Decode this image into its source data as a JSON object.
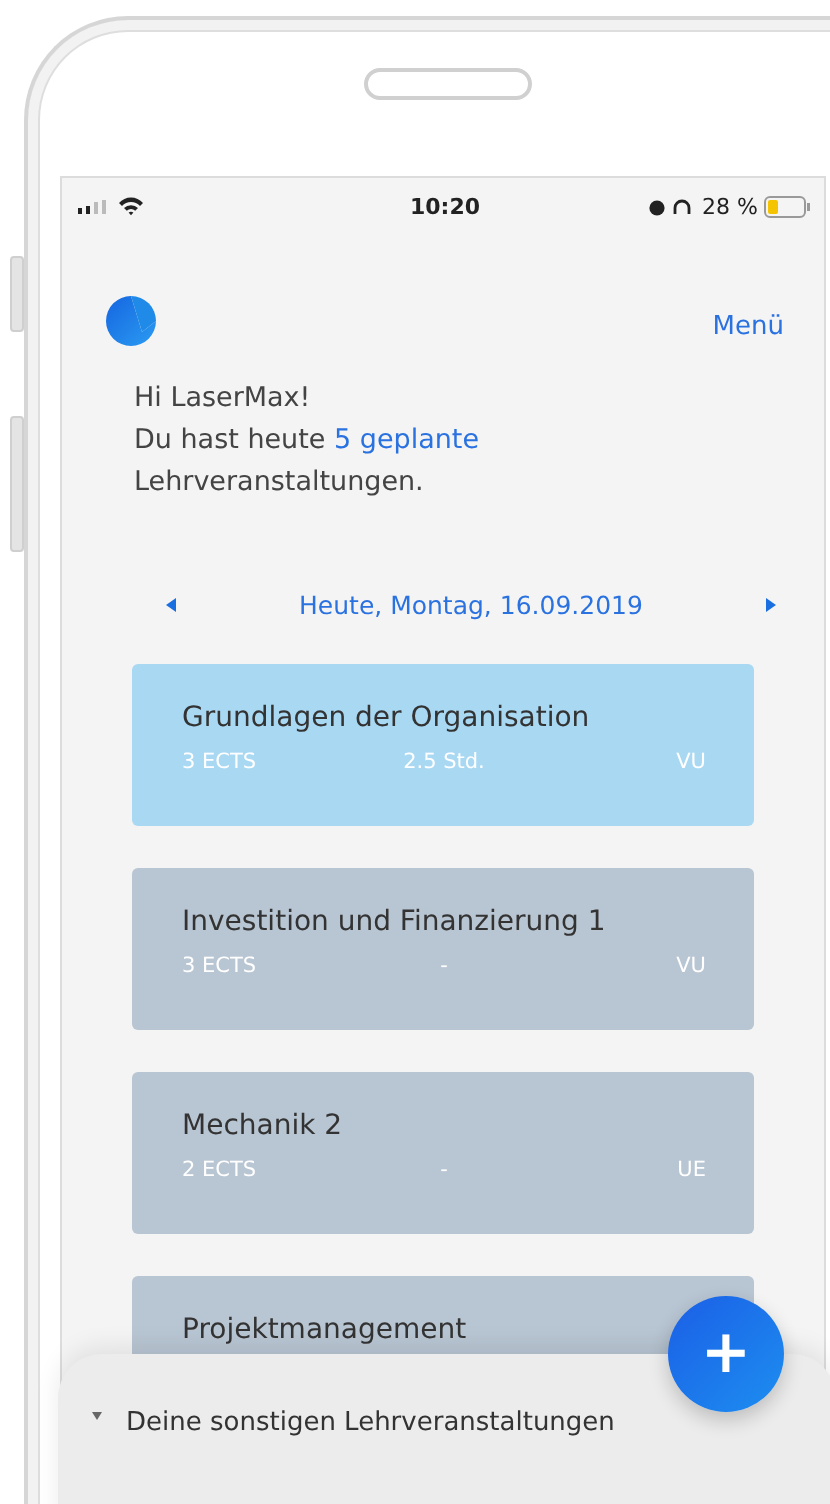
{
  "status_bar": {
    "time": "10:20",
    "battery": "28 %"
  },
  "header": {
    "menu": "Menü"
  },
  "greeting": {
    "hello": "Hi LaserMax!",
    "before": "Du hast heute",
    "highlight": "5 geplante",
    "after": "Lehrveranstaltungen."
  },
  "date_nav": {
    "label": "Heute, Montag, 16.09.2019"
  },
  "courses": [
    {
      "title": "Grundlagen der Organisation",
      "ects": "3 ECTS",
      "duration": "2.5 Std.",
      "type": "VU",
      "selected": true
    },
    {
      "title": "Investition und Finanzierung 1",
      "ects": "3 ECTS",
      "duration": "-",
      "type": "VU",
      "selected": false
    },
    {
      "title": "Mechanik 2",
      "ects": "2 ECTS",
      "duration": "-",
      "type": "UE",
      "selected": false
    },
    {
      "title": "Projektmanagement",
      "selected": false
    }
  ],
  "bottom_sheet": {
    "title": "Deine sonstigen Lehrveranstaltungen",
    "expanded": false
  },
  "fab": {
    "label": "+"
  }
}
